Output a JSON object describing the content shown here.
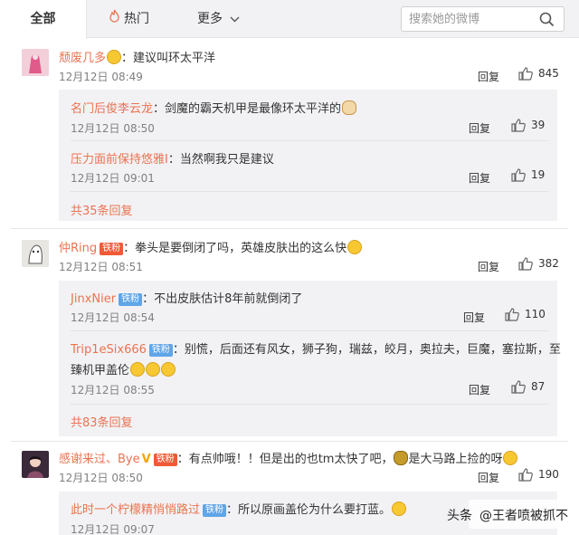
{
  "tabs": {
    "all": "全部",
    "hot": "热门",
    "more": "更多"
  },
  "search": {
    "placeholder": "搜索她的微博"
  },
  "comments": [
    {
      "name": "颓废几多",
      "text": "：建议叫环太平洋",
      "time": "12月12日 08:49",
      "reply": "回复",
      "likes": "845",
      "subs": [
        {
          "name": "名门后俊李云龙",
          "text": "：剑魔的霸天机甲是最像环太平洋的",
          "time": "12月12日 08:50",
          "reply": "回复",
          "likes": "39"
        },
        {
          "name": "压力面前保持悠雅I",
          "text": "：当然啊我只是建议",
          "time": "12月12日 09:01",
          "reply": "回复",
          "likes": "19"
        }
      ],
      "more": "共35条回复"
    },
    {
      "name": "仲Ring",
      "badge": "铁粉",
      "text": "：拳头是要倒闭了吗，英雄皮肤出的这么快",
      "time": "12月12日 08:51",
      "reply": "回复",
      "likes": "382",
      "subs": [
        {
          "name": "JinxNier",
          "badge": "铁粉",
          "text": "：不出皮肤估计8年前就倒闭了",
          "time": "12月12日 08:54",
          "reply": "回复",
          "likes": "110"
        },
        {
          "name": "Trip1eSix666",
          "badge": "铁粉",
          "text": "：别慌，后面还有风女，狮子狗，瑞兹，皎月，奥拉夫，巨魔，塞拉斯，至",
          "text2": "臻机甲盖伦",
          "time": "12月12日 08:55",
          "reply": "回复",
          "likes": "87"
        }
      ],
      "more": "共83条回复"
    },
    {
      "name": "感谢来过、Bye",
      "badge": "铁粉",
      "text": "：有点帅哦！！但是出的也tm太快了吧，",
      "text_b": "是大马路上捡的呀",
      "time": "12月12日 08:50",
      "reply": "回复",
      "likes": "190",
      "subs": [
        {
          "name": "此时一个柠檬精悄悄路过",
          "badge": "铁粉",
          "text": "：所以原画盖伦为什么要打蓝。",
          "time": "12月12日 09:07"
        }
      ]
    }
  ],
  "watermark": {
    "prefix": "头条",
    "handle": "@王者喷被抓不"
  },
  "colors": {
    "username": "#eb7350",
    "badge": "#5fa5e8",
    "subbox": "#f2f2f5"
  }
}
